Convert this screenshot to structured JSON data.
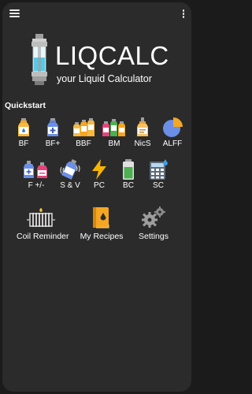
{
  "header": {
    "menu_icon": "hamburger-menu-icon",
    "more_icon": "more-vertical-icon"
  },
  "hero": {
    "title": "LIQCALC",
    "subtitle": "your Liquid Calculator"
  },
  "quickstart": {
    "title": "Quickstart",
    "row1": [
      {
        "label": "BF",
        "icon": "bottle-icon"
      },
      {
        "label": "BF+",
        "icon": "bottle-plus-icon"
      },
      {
        "label": "BBF",
        "icon": "bottles-icon"
      },
      {
        "label": "BM",
        "icon": "bottle-mix-icon"
      },
      {
        "label": "NicS",
        "icon": "nicotine-shot-icon"
      },
      {
        "label": "ALFF",
        "icon": "pie-chart-icon"
      }
    ],
    "row2": [
      {
        "label": "F +/-",
        "icon": "flavor-adjust-icon"
      },
      {
        "label": "S & V",
        "icon": "shake-vape-icon"
      },
      {
        "label": "PC",
        "icon": "lightning-icon"
      },
      {
        "label": "BC",
        "icon": "battery-icon"
      },
      {
        "label": "SC",
        "icon": "calculator-icon"
      }
    ]
  },
  "tools": [
    {
      "label": "Coil Reminder",
      "icon": "coil-icon"
    },
    {
      "label": "My Recipes",
      "icon": "recipe-book-icon"
    },
    {
      "label": "Settings",
      "icon": "gears-icon"
    }
  ],
  "colors": {
    "background": "#2b2b2b",
    "accent_orange": "#f5a623",
    "accent_blue": "#5b7fd6",
    "accent_pink": "#e2457a",
    "accent_green": "#4caf50"
  }
}
